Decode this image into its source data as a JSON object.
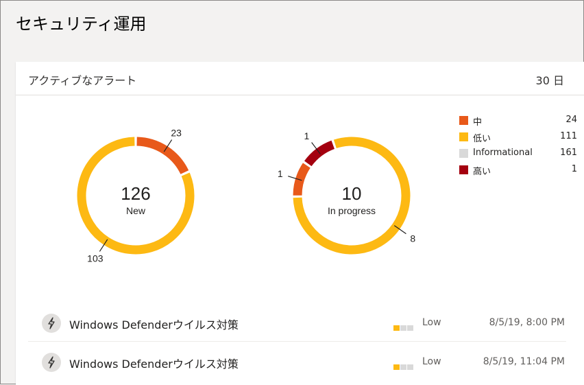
{
  "page": {
    "title": "セキュリティ運用"
  },
  "card": {
    "title": "アクティブなアラート",
    "range": "30 日"
  },
  "colors": {
    "medium": "#e8591a",
    "low": "#fdb913",
    "informational": "#d9d9d9",
    "high": "#a4000f"
  },
  "chart_data": [
    {
      "type": "pie",
      "title": "",
      "center_value": "126",
      "center_label": "New",
      "slices": [
        {
          "label": "中",
          "value": 23,
          "color": "#e8591a"
        },
        {
          "label": "低い",
          "value": 103,
          "color": "#fdb913"
        }
      ]
    },
    {
      "type": "pie",
      "title": "",
      "center_value": "10",
      "center_label": "In progress",
      "slices": [
        {
          "label": "高い",
          "value": 1,
          "color": "#a4000f"
        },
        {
          "label": "低い",
          "value": 8,
          "color": "#fdb913"
        },
        {
          "label": "中",
          "value": 1,
          "color": "#e8591a"
        }
      ]
    }
  ],
  "legend": [
    {
      "label": "中",
      "count": "24",
      "color": "#e8591a"
    },
    {
      "label": "低い",
      "count": "111",
      "color": "#fdb913"
    },
    {
      "label": "Informational",
      "count": "161",
      "color": "#d9d9d9"
    },
    {
      "label": "高い",
      "count": "1",
      "color": "#a4000f"
    }
  ],
  "alerts": [
    {
      "name": "Windows Defenderウイルス対策",
      "severity": "Low",
      "time": "8/5/19, 8:00 PM",
      "icon": "lightning-icon"
    },
    {
      "name": "Windows Defenderウイルス対策",
      "severity": "Low",
      "time": "8/5/19, 11:04 PM",
      "icon": "lightning-icon"
    }
  ]
}
